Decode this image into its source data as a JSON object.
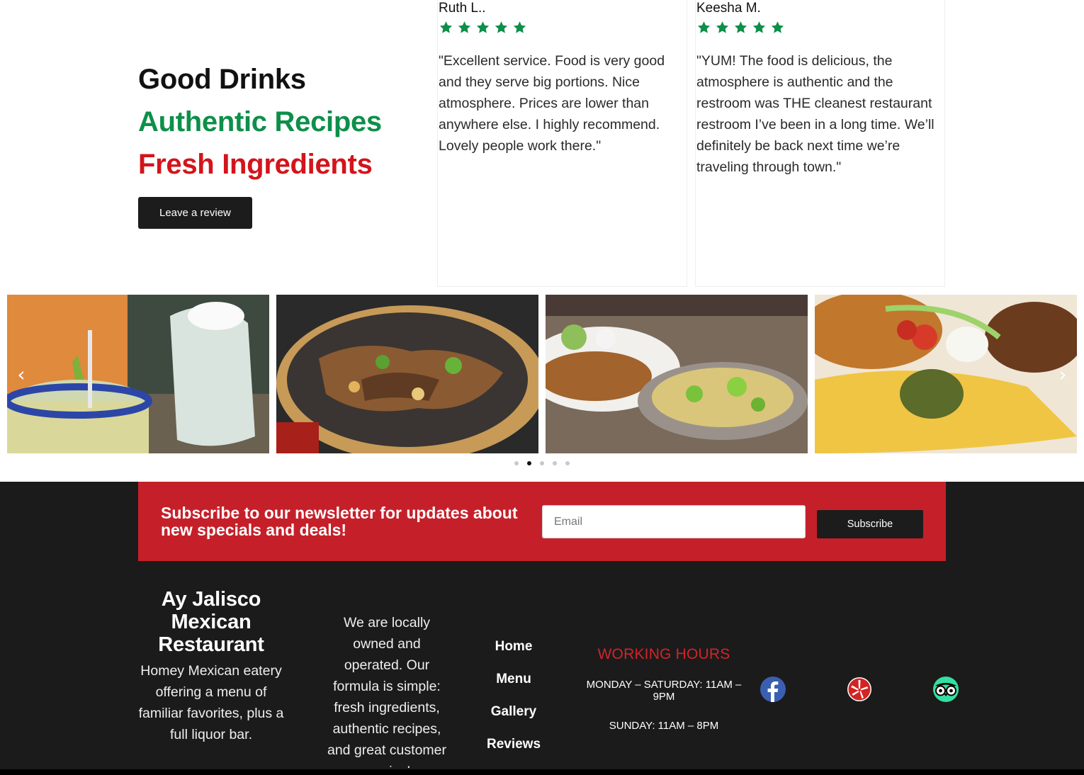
{
  "hero": {
    "line1": "Good Drinks",
    "line2": "Authentic Recipes",
    "line3": "Fresh Ingredients",
    "button_label": "Leave a review"
  },
  "reviews": [
    {
      "name": "Ruth L..",
      "stars": 5,
      "text": "\"Excellent service. Food is very good and they serve big portions. Nice atmosphere. Prices are lower than anywhere else. I highly recommend. Lovely people work there.\""
    },
    {
      "name": "Keesha M.",
      "stars": 5,
      "text": "\"YUM! The food is delicious, the atmosphere is authentic and the restroom was THE cleanest restaurant restroom I’ve been in a long time. We’ll definitely be back next time we’re traveling through town.\""
    }
  ],
  "gallery": {
    "photos": [
      "margarita-photo",
      "fajitas-skillet-photo",
      "fajitas-plate-photo",
      "enchilada-plate-photo"
    ],
    "prev_icon": "‹",
    "next_icon": "›",
    "active_dot": 1,
    "dot_count": 5
  },
  "newsletter": {
    "text": "Subscribe to our newsletter for updates about new specials and deals!",
    "email_placeholder": "Email",
    "button_label": "Subscribe"
  },
  "footer": {
    "brand_name": "Ay Jalisco Mexican Restaurant",
    "brand_desc": "Homey Mexican eatery offering a menu of familiar favorites, plus a full liquor bar.",
    "about": "We are locally owned and operated. Our formula is simple: fresh ingredients, authentic recipes, and great customer service!",
    "nav": [
      "Home",
      "Menu",
      "Gallery",
      "Reviews"
    ],
    "hours_title": "WORKING HOURS",
    "hours_weekday": "MONDAY – SATURDAY: 11AM – 9PM",
    "hours_sunday": "SUNDAY: 11AM – 8PM",
    "social_icons": [
      "facebook-icon",
      "yelp-icon",
      "tripadvisor-icon"
    ]
  },
  "colors": {
    "green": "#0d8f4a",
    "red": "#d3141b",
    "newsletter_bg": "#c5202a",
    "footer_bg": "#1c1b1b",
    "star": "#0d8f4a"
  }
}
